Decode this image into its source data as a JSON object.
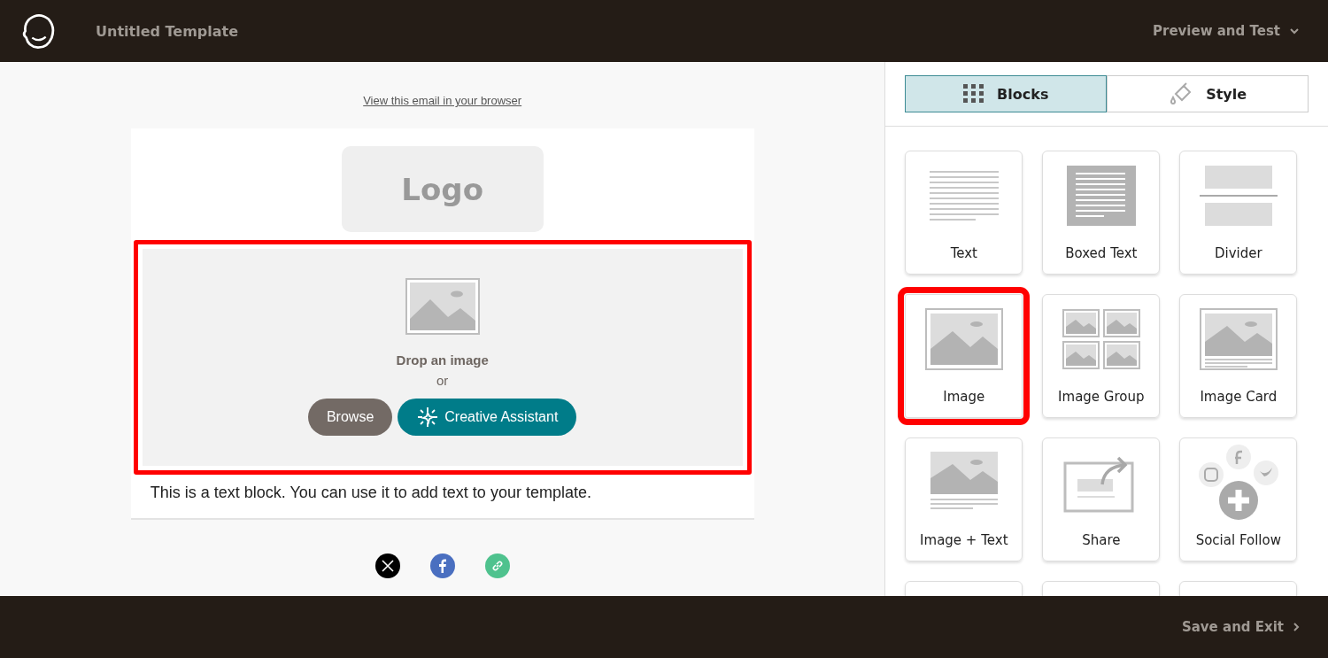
{
  "header": {
    "title": "Untitled Template",
    "menu": "Preview and Test"
  },
  "email": {
    "browser_link": "View this email in your browser",
    "logo": "Logo",
    "image_block": {
      "highlighted": true,
      "drop_text": "Drop an image",
      "or_text": "or",
      "buttons": [
        {
          "label": "Browse",
          "kind": "plain"
        },
        {
          "label": "Creative Assistant",
          "kind": "assistant"
        }
      ]
    },
    "text_block": "This is a text block. You can use it to add text to your template.",
    "social": [
      {
        "kind": "x"
      },
      {
        "kind": "facebook"
      },
      {
        "kind": "link"
      }
    ]
  },
  "tabs": [
    {
      "label": "Blocks",
      "kind": "grid",
      "selected": true
    },
    {
      "label": "Style",
      "kind": "brush",
      "selected": false
    }
  ],
  "blocks": [
    {
      "label": "Text",
      "kind": "text",
      "highlighted": false
    },
    {
      "label": "Boxed Text",
      "kind": "boxed_text",
      "highlighted": false
    },
    {
      "label": "Divider",
      "kind": "divider",
      "highlighted": false
    },
    {
      "label": "Image",
      "kind": "image",
      "highlighted": true
    },
    {
      "label": "Image Group",
      "kind": "image_group",
      "highlighted": false
    },
    {
      "label": "Image Card",
      "kind": "image_card",
      "highlighted": false
    },
    {
      "label": "Image + Text",
      "kind": "image_text",
      "highlighted": false
    },
    {
      "label": "Share",
      "kind": "share",
      "highlighted": false
    },
    {
      "label": "Social Follow",
      "kind": "social_follow",
      "highlighted": false
    },
    {
      "kind": "partial",
      "highlighted": false
    },
    {
      "kind": "partial",
      "highlighted": false
    },
    {
      "kind": "partial",
      "highlighted": false
    }
  ],
  "footer": {
    "action": "Save and Exit"
  }
}
